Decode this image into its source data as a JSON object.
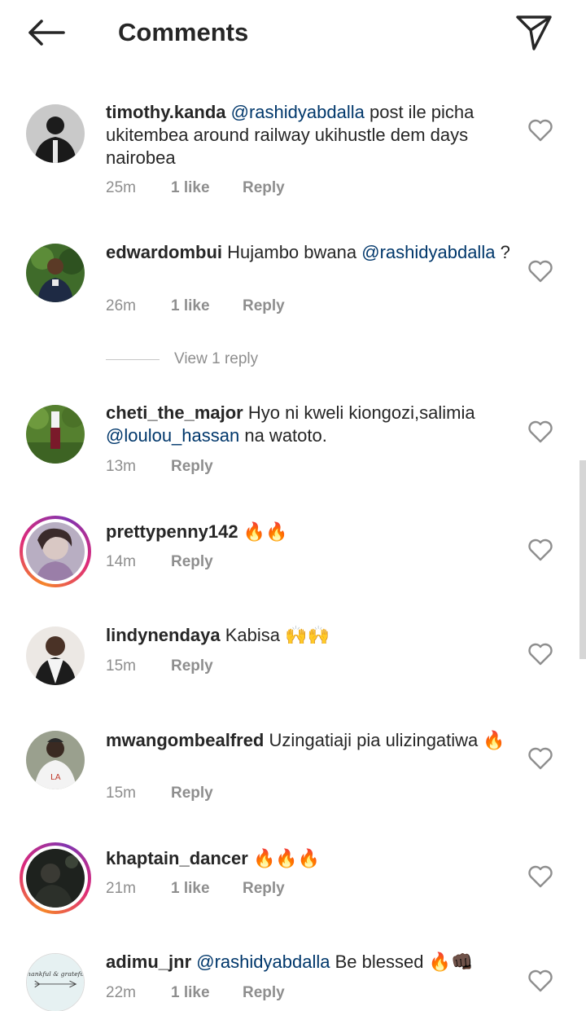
{
  "header": {
    "title": "Comments",
    "back_icon": "arrow-left-icon",
    "send_icon": "paper-plane-icon"
  },
  "comments": [
    {
      "username": "timothy.kanda",
      "mention": "@rashidyabdalla",
      "text": " post ile picha ukitembea around railway ukihustle dem days nairobea",
      "time": "25m",
      "likes": "1 like",
      "reply": "Reply",
      "story_ring": false
    },
    {
      "username": "edwardombui",
      "text": " Hujambo bwana ",
      "mention": "@rashidyabdalla",
      "text_after": " ?",
      "time": "26m",
      "likes": "1 like",
      "reply": "Reply",
      "story_ring": false,
      "view_replies": "View 1 reply"
    },
    {
      "username": "cheti_the_major",
      "text": " Hyo ni kweli kiongozi,salimia ",
      "mention": "@loulou_hassan",
      "text_after": "  na watoto.",
      "time": "13m",
      "reply": "Reply",
      "story_ring": false
    },
    {
      "username": "prettypenny142",
      "text": " 🔥🔥",
      "time": "14m",
      "reply": "Reply",
      "story_ring": true
    },
    {
      "username": "lindynendaya",
      "text": " Kabisa 🙌🙌",
      "time": "15m",
      "reply": "Reply",
      "story_ring": false
    },
    {
      "username": "mwangombealfred",
      "text": " Uzingatiaji pia ulizingatiwa 🔥",
      "time": "15m",
      "reply": "Reply",
      "story_ring": false
    },
    {
      "username": "khaptain_dancer",
      "text": " 🔥🔥🔥",
      "time": "21m",
      "likes": "1 like",
      "reply": "Reply",
      "story_ring": true
    },
    {
      "username": "adimu_jnr",
      "mention": "@rashidyabdalla",
      "text": "  Be blessed 🔥👊🏿",
      "time": "22m",
      "likes": "1 like",
      "reply": "Reply",
      "story_ring": false,
      "avatar_text": "thankful & grateful"
    }
  ],
  "colors": {
    "mention": "#00376b",
    "meta": "#8e8e8e",
    "text": "#262626"
  }
}
